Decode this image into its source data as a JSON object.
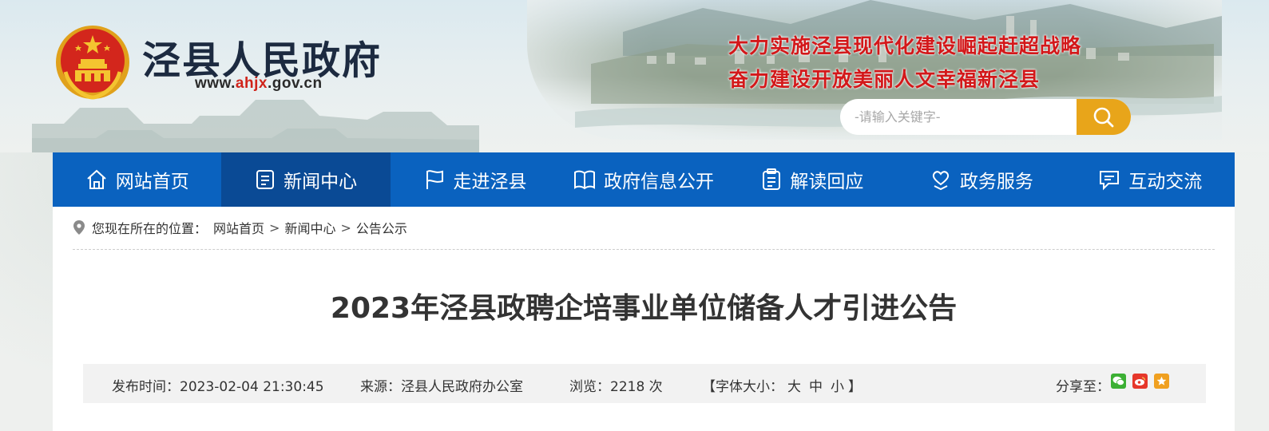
{
  "header": {
    "site_title": "泾县人民政府",
    "url_prefix": "www.",
    "url_highlight": "ahjx",
    "url_suffix": ".gov.cn",
    "slogan_line1": "大力实施泾县现代化建设崛起赶超战略",
    "slogan_line2": "奋力建设开放美丽人文幸福新泾县",
    "search": {
      "placeholder": "-请输入关键字-",
      "button_icon": "search-icon"
    }
  },
  "nav": {
    "items": [
      {
        "label": "网站首页",
        "icon": "home-icon",
        "active": false
      },
      {
        "label": "新闻中心",
        "icon": "news-icon",
        "active": true
      },
      {
        "label": "走进泾县",
        "icon": "flag-icon",
        "active": false
      },
      {
        "label": "政府信息公开",
        "icon": "book-icon",
        "active": false
      },
      {
        "label": "解读回应",
        "icon": "clipboard-icon",
        "active": false
      },
      {
        "label": "政务服务",
        "icon": "heart-hand-icon",
        "active": false
      },
      {
        "label": "互动交流",
        "icon": "chat-icon",
        "active": false
      }
    ]
  },
  "breadcrumb": {
    "prefix": "您现在所在的位置：",
    "items": [
      "网站首页",
      "新闻中心",
      "公告公示"
    ],
    "separator": ">"
  },
  "article": {
    "title": "2023年泾县政聘企培事业单位储备人才引进公告",
    "meta": {
      "publish_time": "发布时间：2023-02-04 21:30:45",
      "source": "来源：泾县人民政府办公室",
      "views": "浏览：2218 次",
      "font_size_open": "【字体大小：",
      "font_large": "大",
      "font_medium": "中",
      "font_small": "小",
      "font_size_close": "】",
      "share_label": "分享至："
    }
  },
  "colors": {
    "nav_bg": "#0a62bf",
    "nav_active": "#0a4a95",
    "slogan": "#d3181a",
    "search_button": "#e8a51a",
    "url_highlight": "#d0231a",
    "wechat": "#3cb034",
    "weibo": "#e6372b",
    "favorite": "#f0a020"
  }
}
